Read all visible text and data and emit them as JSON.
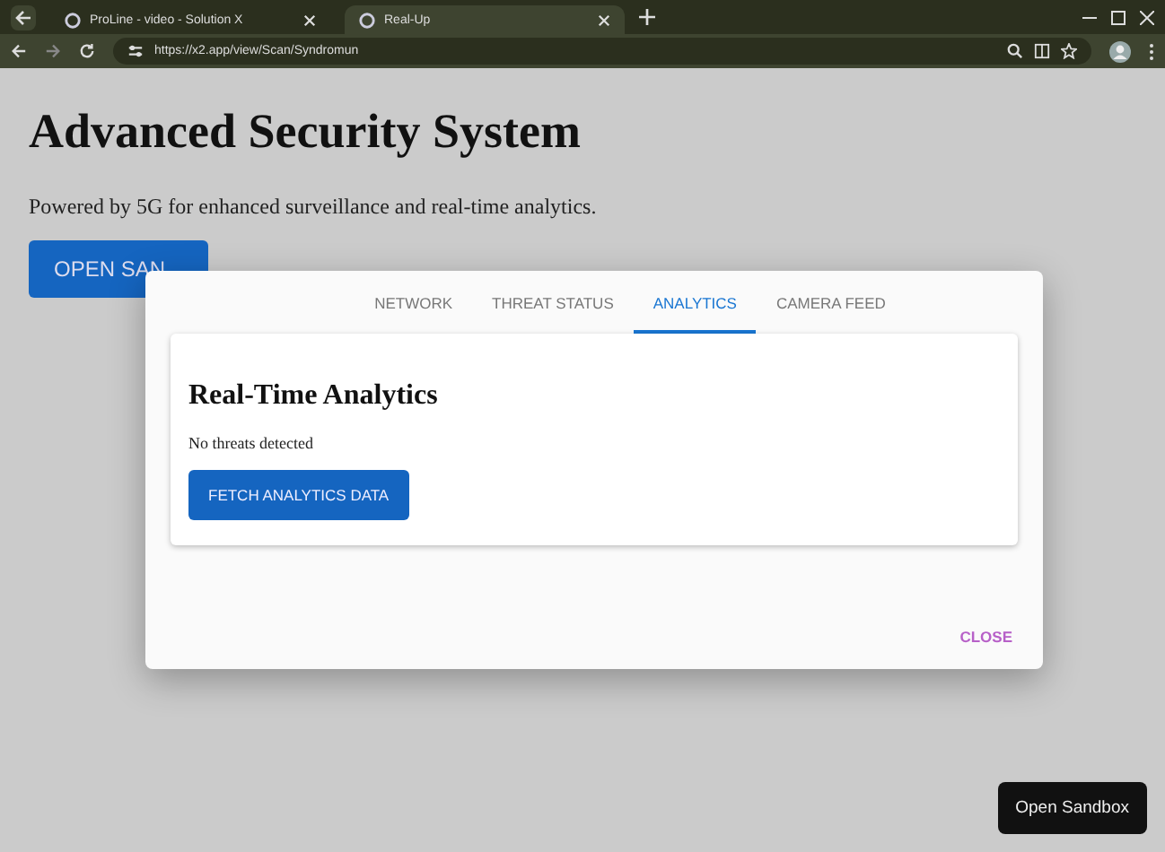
{
  "browser": {
    "tabs": [
      {
        "title": "ProLine - video - Solution X",
        "selected": false
      },
      {
        "title": "Real-Up",
        "selected": true
      }
    ],
    "url": "https://x2.app/view/Scan/Syndromun"
  },
  "page": {
    "title": "Advanced Security System",
    "subtitle": "Powered by 5G for enhanced surveillance and real-time analytics.",
    "open_button": "OPEN SAN"
  },
  "dialog": {
    "tabs": [
      {
        "label": "NETWORK",
        "selected": false
      },
      {
        "label": "THREAT STATUS",
        "selected": false
      },
      {
        "label": "ANALYTICS",
        "selected": true
      },
      {
        "label": "CAMERA FEED",
        "selected": false
      }
    ],
    "panel": {
      "heading": "Real-Time Analytics",
      "status": "No threats detected",
      "button": "FETCH ANALYTICS DATA"
    },
    "close": "CLOSE"
  },
  "sandbox_button": "Open Sandbox"
}
